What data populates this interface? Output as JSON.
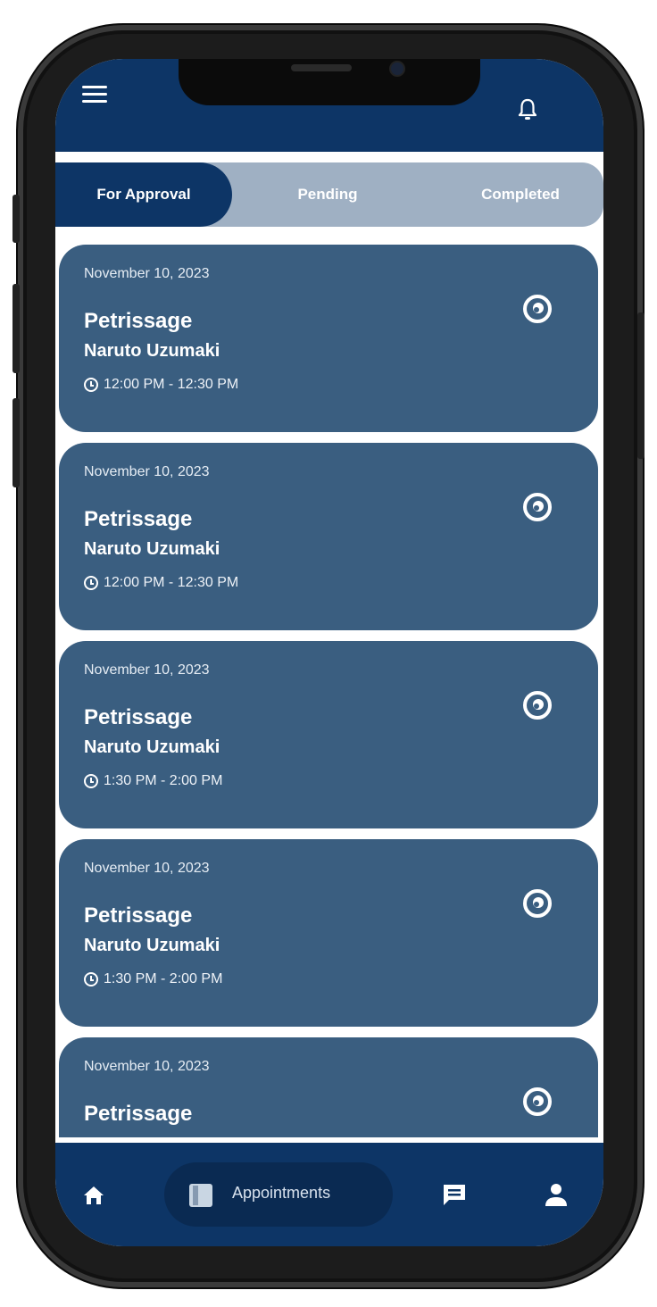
{
  "colors": {
    "header": "#0d3566",
    "card": "#3a5e80",
    "tab_bar": "#9fb0c3"
  },
  "header": {
    "menu_icon": "hamburger-icon",
    "bell_icon": "bell-icon"
  },
  "tabs": [
    {
      "label": "For Approval",
      "active": true
    },
    {
      "label": "Pending",
      "active": false
    },
    {
      "label": "Completed",
      "active": false
    }
  ],
  "appointments": [
    {
      "date": "November 10, 2023",
      "service": "Petrissage",
      "client": "Naruto Uzumaki",
      "time": "12:00 PM - 12:30 PM"
    },
    {
      "date": "November 10, 2023",
      "service": "Petrissage",
      "client": "Naruto Uzumaki",
      "time": "12:00 PM - 12:30 PM"
    },
    {
      "date": "November 10, 2023",
      "service": "Petrissage",
      "client": "Naruto Uzumaki",
      "time": "1:30 PM - 2:00 PM"
    },
    {
      "date": "November 10, 2023",
      "service": "Petrissage",
      "client": "Naruto Uzumaki",
      "time": "1:30 PM - 2:00 PM"
    },
    {
      "date": "November 10, 2023",
      "service": "Petrissage",
      "client": "",
      "time": ""
    }
  ],
  "bottom_nav": {
    "home_icon": "home-icon",
    "appointments_label": "Appointments",
    "chat_icon": "chat-icon",
    "profile_icon": "profile-icon"
  }
}
